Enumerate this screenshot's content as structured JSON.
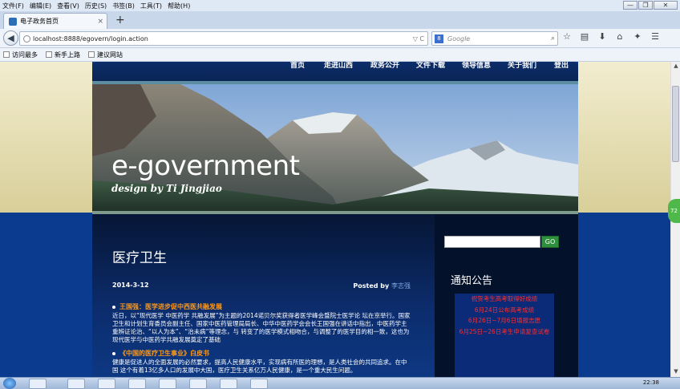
{
  "menu": [
    "文件(F)",
    "编辑(E)",
    "查看(V)",
    "历史(S)",
    "书签(B)",
    "工具(T)",
    "帮助(H)"
  ],
  "window_buttons": [
    "—",
    "❐",
    "✕"
  ],
  "tab": {
    "title": "电子政务首页",
    "close": "×",
    "new": "+"
  },
  "url": "localhost:8888/egovern/login.action",
  "url_icons": "▽ C",
  "search": {
    "engine": "8",
    "placeholder": "Google"
  },
  "toolbar_icons": [
    "star-icon",
    "clipboard-icon",
    "download-icon",
    "home-icon",
    "addon-icon",
    "menu-icon"
  ],
  "bookmarks": [
    "访问最多",
    "新手上路",
    "建议网站"
  ],
  "site": {
    "nav": [
      "首页",
      "走进山西",
      "政务公开",
      "文件下载",
      "领导信息",
      "关于我们",
      "登出"
    ],
    "banner_title": "e-government",
    "banner_subtitle": "design by Ti Jingjiao",
    "section_title": "医疗卫生",
    "date": "2014-3-12",
    "posted_by_label": "Posted by",
    "author": "李志强",
    "articles": [
      {
        "title": "王国强：医学进步促中西医共融发展",
        "body": "近日，以“现代医学 中医药学 共融发展”为主题的2014诺贝尔奖获得者医学峰会暨院士医学论 坛在京举行。国家卫生和计划生育委员会副主任、国家中医药管理局局长、中华中医药学会会长王国强在讲话中指出，中医药学主重辨证论治、“以人为本”、“治未病”等理念，与 转变了的医学模式相吻合，与调整了的医学目的相一致，这也为现代医学与中医药学共融发展奠定了基础"
      },
      {
        "title": "《中国的医疗卫生事业》白皮书",
        "body": "健康是促进人的全面发展的必然要求，提高人民健康水平，实现病有所医的理想，是人类社会的共同追求。在中国 这个有着13亿多人口的发展中大国，医疗卫生关系亿万人民健康，是一个重大民生问题。"
      }
    ],
    "search_go": "GO",
    "notice_title": "通知公告",
    "notices": [
      "祝贺考生高考取得好成绩",
      "6月24日公布高考成绩",
      "6月26日~7月6日填报志愿",
      "6月25日~26日考生申请复查试卷"
    ]
  },
  "side_badge": "72",
  "clock": "22:38",
  "colors": {
    "page_bg": "#0a3a8c",
    "nav_bg": "#0c2e6a",
    "article_title": "#ff9a1a",
    "notice_text": "#ff2d2d",
    "go_button": "#2e8f3d"
  }
}
